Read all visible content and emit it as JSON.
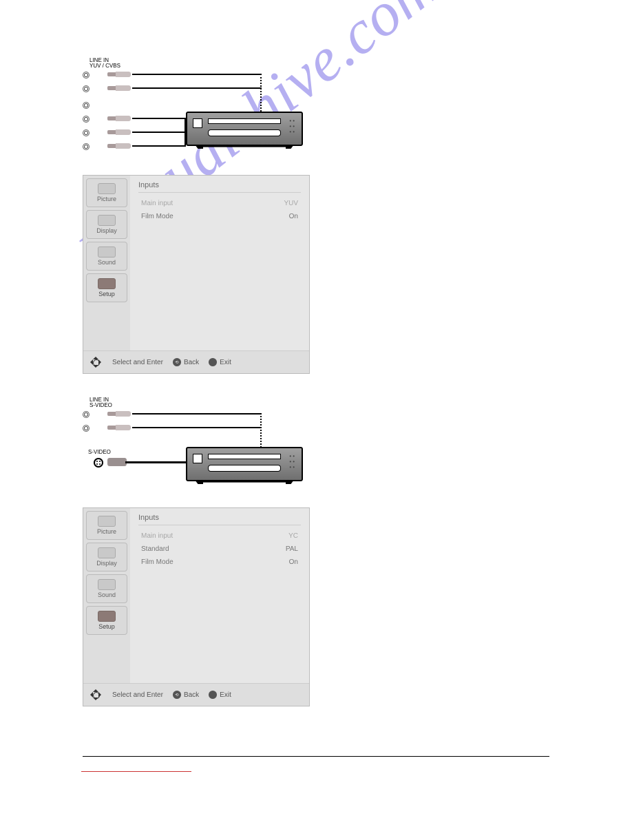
{
  "watermark": "manualshive.com",
  "diagram1": {
    "header": "LINE IN\nYUV / CVBS"
  },
  "diagram2": {
    "header": "LINE IN\nS-VIDEO",
    "svideo_label": "S-VIDEO"
  },
  "osd": {
    "tabs": {
      "picture": "Picture",
      "display": "Display",
      "sound": "Sound",
      "setup": "Setup"
    },
    "title": "Inputs",
    "rows_common": {
      "main_input": "Main input",
      "standard": "Standard",
      "film_mode": "Film Mode"
    },
    "values1": {
      "main_input": "YUV",
      "film_mode": "On"
    },
    "values2": {
      "main_input": "YC",
      "standard": "PAL",
      "film_mode": "On"
    },
    "footer": {
      "select": "Select and Enter",
      "back": "Back",
      "exit": "Exit"
    }
  }
}
